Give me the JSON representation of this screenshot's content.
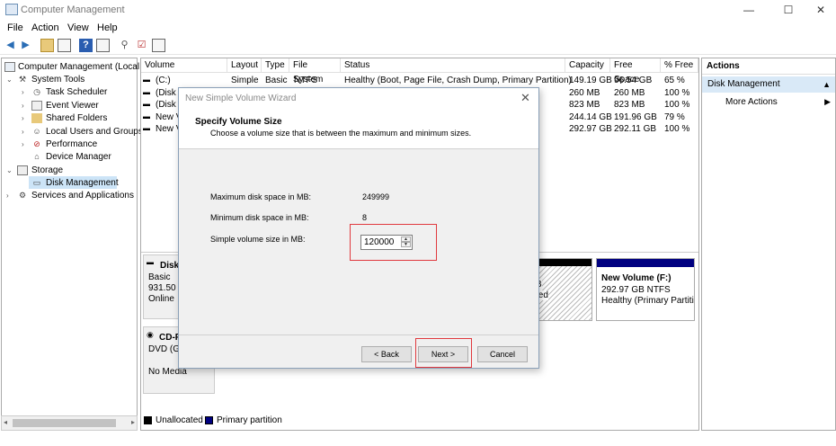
{
  "window": {
    "title": "Computer Management",
    "minimize": "—",
    "maximize": "☐",
    "close": "✕"
  },
  "menu": [
    "File",
    "Action",
    "View",
    "Help"
  ],
  "tree": {
    "root": "Computer Management (Local",
    "system_tools": "System Tools",
    "task_scheduler": "Task Scheduler",
    "event_viewer": "Event Viewer",
    "shared_folders": "Shared Folders",
    "local_users": "Local Users and Groups",
    "performance": "Performance",
    "device_manager": "Device Manager",
    "storage": "Storage",
    "disk_management": "Disk Management",
    "services": "Services and Applications"
  },
  "volume_table": {
    "headers": [
      "Volume",
      "Layout",
      "Type",
      "File System",
      "Status",
      "Capacity",
      "Free Space",
      "% Free"
    ],
    "rows": [
      {
        "volume": "(C:)",
        "layout": "Simple",
        "type": "Basic",
        "fs": "NTFS",
        "status": "Healthy (Boot, Page File, Crash Dump, Primary Partition)",
        "capacity": "149.19 GB",
        "free": "96.54 GB",
        "pct": "65 %"
      },
      {
        "volume": "(Disk 0",
        "layout": "",
        "type": "",
        "fs": "",
        "status": "",
        "capacity": "260 MB",
        "free": "260 MB",
        "pct": "100 %"
      },
      {
        "volume": "(Disk 0",
        "layout": "",
        "type": "",
        "fs": "",
        "status": "",
        "capacity": "823 MB",
        "free": "823 MB",
        "pct": "100 %"
      },
      {
        "volume": "New V",
        "layout": "",
        "type": "",
        "fs": "",
        "status": "",
        "capacity": "244.14 GB",
        "free": "191.96 GB",
        "pct": "79 %"
      },
      {
        "volume": "New V",
        "layout": "",
        "type": "",
        "fs": "",
        "status": "",
        "capacity": "292.97 GB",
        "free": "292.11 GB",
        "pct": "100 %"
      }
    ]
  },
  "disk_map": {
    "disk_label": "Disk",
    "disk_type": "Basic",
    "disk_size": "931.50 G",
    "disk_status": "Online",
    "partial_text_1": "B",
    "partial_text_2": "ted",
    "new_volume_title": "New Volume  (F:)",
    "new_volume_size": "292.97 GB NTFS",
    "new_volume_status": "Healthy (Primary Partiti",
    "cd_label": "CD-R",
    "cd_type": "DVD (G:)",
    "cd_media": "No Media"
  },
  "legend": {
    "unallocated": "Unallocated",
    "primary": "Primary partition",
    "unallocated_color": "#000000",
    "primary_color": "#000080"
  },
  "actions": {
    "header": "Actions",
    "section": "Disk Management",
    "more": "More Actions"
  },
  "wizard": {
    "title": "New Simple Volume Wizard",
    "heading": "Specify Volume Size",
    "subheading": "Choose a volume size that is between the maximum and minimum sizes.",
    "max_label": "Maximum disk space in MB:",
    "max_value": "249999",
    "min_label": "Minimum disk space in MB:",
    "min_value": "8",
    "size_label": "Simple volume size in MB:",
    "size_value": "120000",
    "back_button": "< Back",
    "next_button": "Next >",
    "cancel_button": "Cancel",
    "highlight_color": "#e0393e"
  }
}
